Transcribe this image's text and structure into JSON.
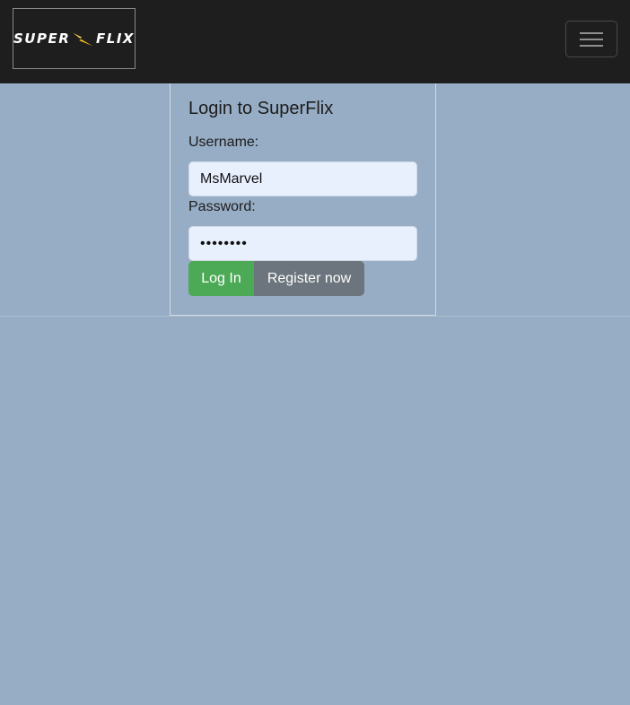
{
  "navbar": {
    "brand": {
      "word_left": "SUPER",
      "word_right": "FLIX",
      "icon": "lightning-bolt-icon"
    },
    "toggler_icon": "hamburger-menu-icon"
  },
  "login": {
    "title": "Login to SuperFlix",
    "username_label": "Username:",
    "username_value": "MsMarvel",
    "password_label": "Password:",
    "password_value": "••••••••",
    "login_button": "Log In",
    "register_button": "Register now"
  },
  "colors": {
    "background": "#97adc5",
    "navbar": "#1e1e1e",
    "login_button": "#4caa56",
    "register_button": "#6c757d",
    "input_bg": "#e8f0fe",
    "bolt": "#f5c518"
  }
}
